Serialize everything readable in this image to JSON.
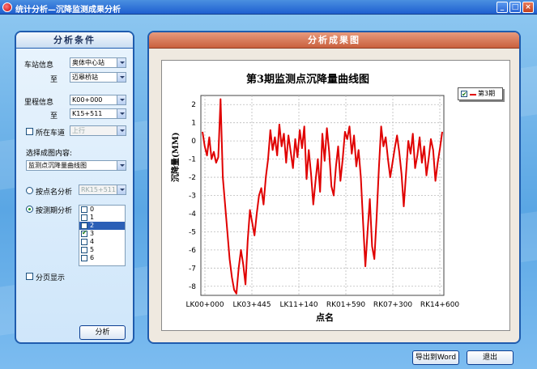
{
  "window": {
    "title": "统计分析—沉降监测成果分析",
    "min_glyph": "_",
    "max_glyph": "□",
    "close_glyph": "×"
  },
  "left_panel": {
    "header": "分析条件",
    "station_label": "车站信息",
    "station_from": "奥体中心站",
    "to_label_1": "至",
    "station_to": "迈皋桥站",
    "mileage_label": "里程信息",
    "mileage_from": "K00+000",
    "to_label_2": "至",
    "mileage_to": "K15+511",
    "lane_label": "所在车道",
    "lane_value": "上行",
    "content_label": "选择成图内容:",
    "content_value": "监测点沉降量曲线图",
    "point_analysis_label": "按点名分析",
    "point_value": "RK15+511",
    "period_analysis_label": "按测期分析",
    "periods": [
      "0",
      "1",
      "2",
      "3",
      "4",
      "5",
      "6"
    ],
    "checked_period": "3",
    "selected_period": "2",
    "paging_label": "分页显示",
    "analyze_button": "分析"
  },
  "right_panel": {
    "header": "分析成果图",
    "export_button": "导出到Word",
    "exit_button": "退出"
  },
  "colors": {
    "series": "#e00000",
    "panel_border": "#1f5cae",
    "result_header": "#c9603e"
  },
  "chart_data": {
    "type": "line",
    "title": "第3期监测点沉降量曲线图",
    "xlabel": "点名",
    "ylabel": "沉降量(MM)",
    "ylim": [
      -8.5,
      2.5
    ],
    "yticks": [
      2,
      1,
      0,
      -1,
      -2,
      -3,
      -4,
      -5,
      -6,
      -7,
      -8
    ],
    "xtick_labels": [
      "LK00+000",
      "LK03+445",
      "LK11+140",
      "RK01+590",
      "RK07+300",
      "RK14+600"
    ],
    "grid": true,
    "legend_position": "top-right",
    "series": [
      {
        "name": "第3期",
        "values": [
          0.5,
          -0.3,
          -0.8,
          0.2,
          -1.0,
          -0.6,
          -1.2,
          -0.9,
          2.3,
          -2.0,
          -3.5,
          -5.0,
          -6.5,
          -7.5,
          -8.2,
          -8.4,
          -7.0,
          -6.0,
          -6.8,
          -7.9,
          -5.5,
          -3.8,
          -4.5,
          -5.2,
          -4.0,
          -3.0,
          -2.6,
          -3.5,
          -2.0,
          -1.0,
          0.6,
          -0.5,
          0.2,
          -0.8,
          0.9,
          -0.3,
          0.4,
          -1.2,
          0.3,
          -0.6,
          -1.5,
          0.1,
          -0.9,
          0.6,
          -0.4,
          0.8,
          -2.1,
          -0.5,
          -1.8,
          -3.5,
          -2.2,
          -1.0,
          -2.8,
          0.4,
          -1.1,
          0.7,
          -0.6,
          -2.5,
          -3.0,
          -1.4,
          -0.3,
          -2.2,
          -1.0,
          0.5,
          0.1,
          0.8,
          -0.7,
          0.3,
          -1.4,
          -0.5,
          -2.0,
          -4.5,
          -6.9,
          -5.0,
          -3.2,
          -5.8,
          -6.5,
          -4.2,
          -1.5,
          0.8,
          -0.3,
          0.2,
          -1.0,
          -2.0,
          -1.2,
          -0.4,
          0.3,
          -0.6,
          -1.8,
          -3.6,
          -1.8,
          0.0,
          -0.7,
          0.4,
          -1.5,
          -0.8,
          0.2,
          -1.2,
          -0.3,
          -1.9,
          -1.0,
          0.1,
          -0.5,
          -2.2,
          -1.2,
          -0.4,
          0.5
        ]
      }
    ]
  }
}
